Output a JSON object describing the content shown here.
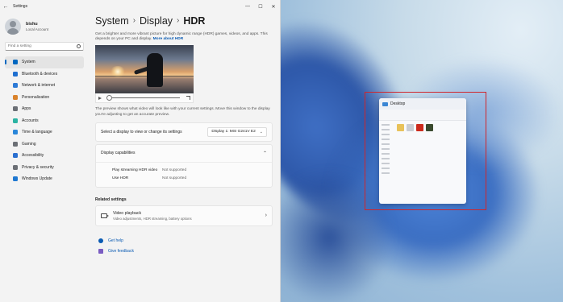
{
  "window": {
    "title": "Settings",
    "back_glyph": "←",
    "controls": [
      "—",
      "☐",
      "✕"
    ]
  },
  "user": {
    "name": "bishu",
    "account": "Local Account"
  },
  "search": {
    "placeholder": "Find a setting"
  },
  "nav": {
    "items": [
      {
        "label": "System",
        "icon": "monitor-icon",
        "color": "#0067c0",
        "active": true
      },
      {
        "label": "Bluetooth & devices",
        "icon": "bluetooth-icon",
        "color": "#1f6fd0"
      },
      {
        "label": "Network & internet",
        "icon": "network-icon",
        "color": "#2d7ad6"
      },
      {
        "label": "Personalization",
        "icon": "brush-icon",
        "color": "#d9822b"
      },
      {
        "label": "Apps",
        "icon": "apps-icon",
        "color": "#6b6f75"
      },
      {
        "label": "Accounts",
        "icon": "person-icon",
        "color": "#2bb3a3"
      },
      {
        "label": "Time & language",
        "icon": "clock-globe-icon",
        "color": "#2a86d9"
      },
      {
        "label": "Gaming",
        "icon": "controller-icon",
        "color": "#6b6f75"
      },
      {
        "label": "Accessibility",
        "icon": "accessibility-icon",
        "color": "#2a6fd0"
      },
      {
        "label": "Privacy & security",
        "icon": "shield-icon",
        "color": "#6b6f75"
      },
      {
        "label": "Windows Update",
        "icon": "update-icon",
        "color": "#1f78d1"
      }
    ]
  },
  "breadcrumb": {
    "part1": "System",
    "sep": "›",
    "part2": "Display",
    "part3": "HDR"
  },
  "intro": {
    "text": "Get a brighter and more vibrant picture for high dynamic range (HDR) games, videos, and apps. This depends on your PC and display.",
    "link": "More about HDR"
  },
  "preview_note": "The preview shows what video will look like with your current settings. Move this window to the display you're adjusting to get an accurate preview.",
  "video_player": {
    "progress": 0.0
  },
  "display_select": {
    "label": "Select a display to view or change its settings",
    "value": "Display 1: MSI G241V E2",
    "chevron": "⌄"
  },
  "capabilities": {
    "title": "Display capabilities",
    "rows": [
      {
        "key": "Play streaming HDR video",
        "value": "Not supported"
      },
      {
        "key": "Use HDR",
        "value": "Not supported"
      }
    ]
  },
  "related": {
    "heading": "Related settings",
    "video_playback": {
      "title": "Video playback",
      "subtitle": "Video adjustments, HDR streaming, battery options",
      "arrow": "›"
    }
  },
  "help": {
    "get_help": "Get help",
    "feedback": "Give feedback"
  },
  "desktop": {
    "thumbnail_title": "Desktop",
    "highlight_color": "#d0262c"
  }
}
